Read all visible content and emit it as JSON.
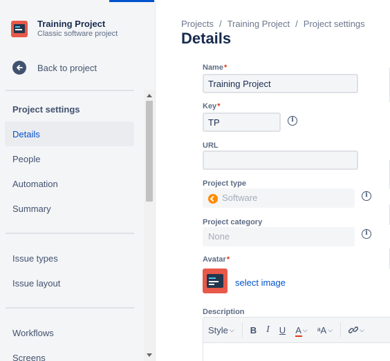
{
  "sidebar": {
    "project_name": "Training Project",
    "project_subtitle": "Classic software project",
    "back_label": "Back to project",
    "section_title": "Project settings",
    "items": [
      {
        "label": "Details"
      },
      {
        "label": "People"
      },
      {
        "label": "Automation"
      },
      {
        "label": "Summary"
      },
      {
        "label": "Issue types"
      },
      {
        "label": "Issue layout"
      },
      {
        "label": "Workflows"
      },
      {
        "label": "Screens"
      }
    ],
    "active_item": "Details"
  },
  "breadcrumbs": [
    "Projects",
    "Training Project",
    "Project settings"
  ],
  "page_title": "Details",
  "form": {
    "name_label": "Name",
    "name_value": "Training Project",
    "key_label": "Key",
    "key_value": "TP",
    "url_label": "URL",
    "url_value": "",
    "type_label": "Project type",
    "type_value": "Software",
    "category_label": "Project category",
    "category_value": "None",
    "avatar_label": "Avatar",
    "select_image": "select image",
    "description_label": "Description",
    "required_mark": "*"
  },
  "toolbar": {
    "style": "Style",
    "bold": "B",
    "italic": "I",
    "underline": "U",
    "font_color": "A",
    "text_size": "ᵃA",
    "link_icon": "link-icon"
  },
  "colors": {
    "accent": "#0052cc",
    "required": "#de350b",
    "project_icon": "#e8594a",
    "software_icon": "#ff8b00"
  }
}
